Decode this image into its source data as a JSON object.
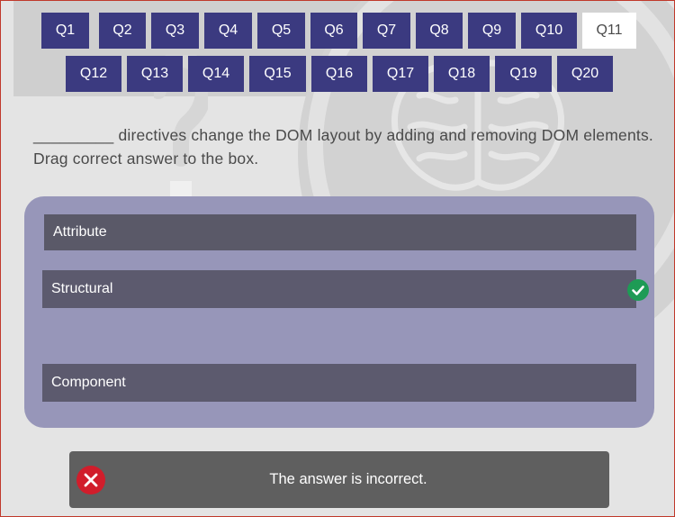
{
  "nav": {
    "row1": [
      "Q1",
      "Q2",
      "Q3",
      "Q4",
      "Q5",
      "Q6",
      "Q7",
      "Q8",
      "Q9",
      "Q10",
      "Q11"
    ],
    "row2": [
      "Q12",
      "Q13",
      "Q14",
      "Q15",
      "Q16",
      "Q17",
      "Q18",
      "Q19",
      "Q20"
    ],
    "active": "Q11"
  },
  "question": {
    "text": "_________ directives change the DOM layout by adding and removing DOM elements. Drag correct answer to the box."
  },
  "answers": {
    "items": [
      "Attribute",
      "Structural",
      "Component"
    ],
    "selected": "Structural"
  },
  "feedback": {
    "text": "The answer is incorrect.",
    "status": "incorrect"
  },
  "colors": {
    "nav_button": "#3b3a80",
    "panel": "#9796b9",
    "answer_box": "#5c5a6e",
    "correct": "#1e9b55",
    "error": "#d11d2b"
  }
}
